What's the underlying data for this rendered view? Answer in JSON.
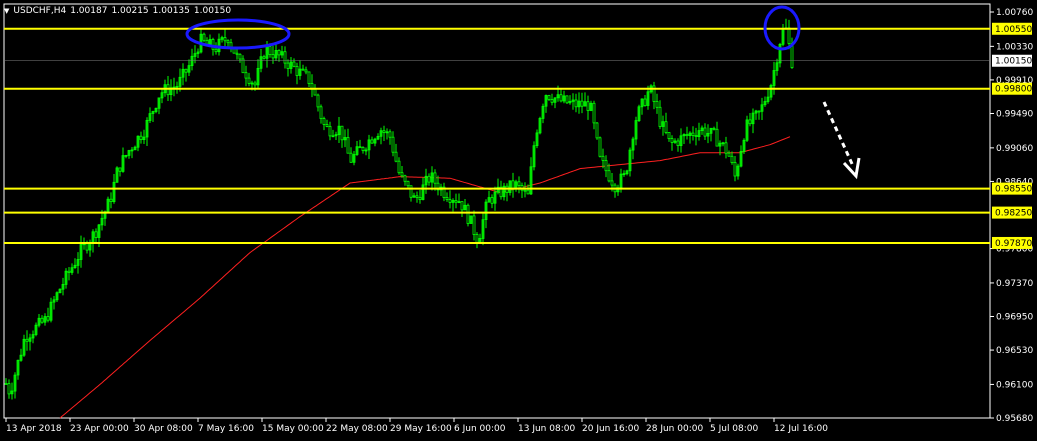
{
  "header": {
    "symbol_timeframe": "USDCHF,H4",
    "quotes": [
      "1.00187",
      "1.00215",
      "1.00135",
      "1.00150"
    ]
  },
  "colors": {
    "background": "#000000",
    "frame": "#ffffff",
    "candles": "#00ff00",
    "moving_average": "#ff2020",
    "levels": "#ffff00",
    "level_label_bg": "#ffff00",
    "level_label_text": "#000000",
    "bid_line": "#808080",
    "annotation_circle": "#1a1aff",
    "arrow": "#ffffff"
  },
  "chart_data": {
    "type": "candlestick",
    "instrument": "USDCHF",
    "timeframe": "H4",
    "ylim": [
      0.9568,
      1.0086
    ],
    "y_ticks": [
      "1.00760",
      "1.00330",
      "0.99910",
      "0.99490",
      "0.99060",
      "0.98640",
      "0.97800",
      "0.97370",
      "0.96950",
      "0.96530",
      "0.96100",
      "0.95680"
    ],
    "x_ticks": [
      "13 Apr 2018",
      "23 Apr 00:00",
      "30 Apr 08:00",
      "7 May 16:00",
      "15 May 00:00",
      "22 May 08:00",
      "29 May 16:00",
      "6 Jun 00:00",
      "13 Jun 08:00",
      "20 Jun 16:00",
      "28 Jun 00:00",
      "5 Jul 08:00",
      "12 Jul 16:00"
    ],
    "horizontal_levels": [
      "1.00550",
      "0.99800",
      "0.98550",
      "0.98250",
      "0.97870"
    ],
    "current_price": "1.00150",
    "price_path_keypoints": [
      [
        0,
        0.9628
      ],
      [
        10,
        0.96
      ],
      [
        25,
        0.967
      ],
      [
        45,
        0.969
      ],
      [
        60,
        0.973
      ],
      [
        80,
        0.9775
      ],
      [
        95,
        0.98
      ],
      [
        110,
        0.984
      ],
      [
        118,
        0.988
      ],
      [
        130,
        0.9905
      ],
      [
        145,
        0.993
      ],
      [
        160,
        0.9975
      ],
      [
        178,
        0.9985
      ],
      [
        190,
        1.001
      ],
      [
        200,
        1.004
      ],
      [
        215,
        1.003
      ],
      [
        228,
        1.0045
      ],
      [
        240,
        1.001
      ],
      [
        255,
        0.9985
      ],
      [
        265,
        1.003
      ],
      [
        280,
        1.002
      ],
      [
        295,
        1.0005
      ],
      [
        310,
        0.999
      ],
      [
        325,
        0.993
      ],
      [
        340,
        0.993
      ],
      [
        350,
        0.989
      ],
      [
        365,
        0.991
      ],
      [
        380,
        0.993
      ],
      [
        390,
        0.992
      ],
      [
        400,
        0.987
      ],
      [
        415,
        0.984
      ],
      [
        430,
        0.987
      ],
      [
        445,
        0.985
      ],
      [
        460,
        0.984
      ],
      [
        470,
        0.9815
      ],
      [
        478,
        0.979
      ],
      [
        488,
        0.984
      ],
      [
        500,
        0.985
      ],
      [
        515,
        0.986
      ],
      [
        528,
        0.9845
      ],
      [
        535,
        0.992
      ],
      [
        545,
        0.9975
      ],
      [
        560,
        0.9965
      ],
      [
        575,
        0.996
      ],
      [
        590,
        0.996
      ],
      [
        600,
        0.989
      ],
      [
        615,
        0.986
      ],
      [
        625,
        0.987
      ],
      [
        635,
        0.994
      ],
      [
        650,
        0.998
      ],
      [
        660,
        0.994
      ],
      [
        670,
        0.991
      ],
      [
        685,
        0.992
      ],
      [
        700,
        0.993
      ],
      [
        715,
        0.992
      ],
      [
        728,
        0.99
      ],
      [
        735,
        0.987
      ],
      [
        745,
        0.993
      ],
      [
        760,
        0.995
      ],
      [
        772,
        0.999
      ],
      [
        780,
        1.004
      ],
      [
        785,
        1.006
      ],
      [
        792,
        1.0015
      ]
    ],
    "moving_average_keypoints": [
      [
        60,
        0.9568
      ],
      [
        100,
        0.961
      ],
      [
        150,
        0.9665
      ],
      [
        200,
        0.9718
      ],
      [
        250,
        0.9775
      ],
      [
        300,
        0.982
      ],
      [
        350,
        0.9862
      ],
      [
        400,
        0.987
      ],
      [
        450,
        0.9868
      ],
      [
        500,
        0.985
      ],
      [
        540,
        0.9862
      ],
      [
        580,
        0.988
      ],
      [
        620,
        0.9885
      ],
      [
        660,
        0.989
      ],
      [
        700,
        0.99
      ],
      [
        740,
        0.99
      ],
      [
        770,
        0.991
      ],
      [
        790,
        0.992
      ]
    ],
    "annotations": [
      "blue circle around May highs",
      "blue circle around July spike high",
      "dashed white arrow pointing down"
    ]
  }
}
